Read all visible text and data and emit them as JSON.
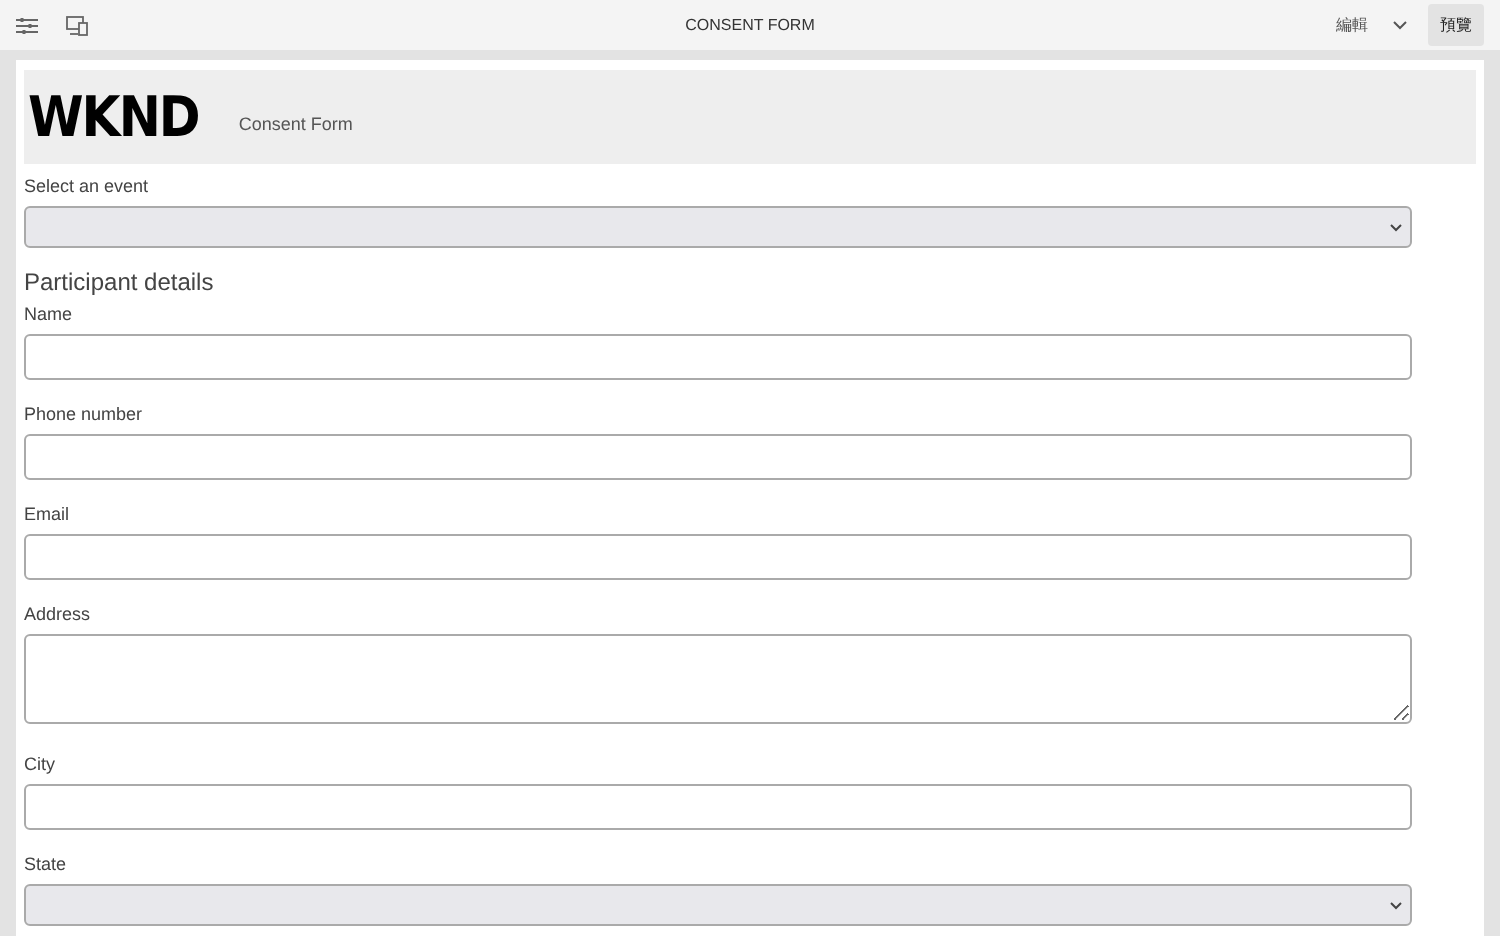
{
  "toolbar": {
    "title": "CONSENT FORM",
    "mode": "編輯",
    "preview_button": "預覽"
  },
  "header": {
    "logo": "WKND",
    "title": "Consent Form"
  },
  "fields": [
    {
      "kind": "select",
      "label": "Select an event"
    },
    {
      "kind": "heading",
      "label": "Participant details"
    },
    {
      "kind": "text",
      "label": "Name"
    },
    {
      "kind": "text",
      "label": "Phone number"
    },
    {
      "kind": "text",
      "label": "Email"
    },
    {
      "kind": "textarea",
      "label": "Address"
    },
    {
      "kind": "text",
      "label": "City"
    },
    {
      "kind": "select",
      "label": "State"
    }
  ]
}
